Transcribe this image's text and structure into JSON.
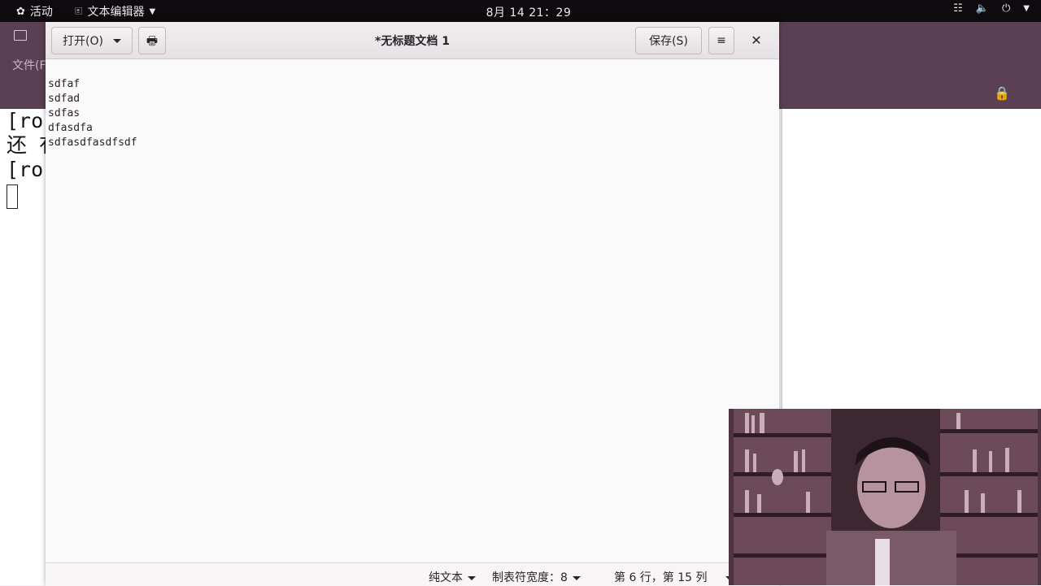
{
  "topbar": {
    "activities": "活动",
    "app_menu": "文本编辑器",
    "clock": "8月 14  21：29",
    "tray": [
      "network-icon",
      "volume-icon",
      "power-icon",
      "chevron-down-icon"
    ]
  },
  "terminal": {
    "menu_partial": "文件(F",
    "lines": [
      "[ro",
      "还 有",
      "[ro"
    ]
  },
  "gedit": {
    "open_label": "打开(O)",
    "title": "*无标题文档 1",
    "save_label": "保存(S)",
    "lines": [
      "sdfaf",
      "sdfad",
      "sdfas",
      "dfasdfa",
      "sdfasdfasdfsdf"
    ],
    "status": {
      "language": "纯文本",
      "tab_width": "制表符宽度：8",
      "position": "第 6 行，第 15 列"
    }
  },
  "colors": {
    "topbar_bg": "#0e0a0d",
    "terminal_header": "#5b3f53",
    "webcam_tone": "#5a3a48"
  }
}
